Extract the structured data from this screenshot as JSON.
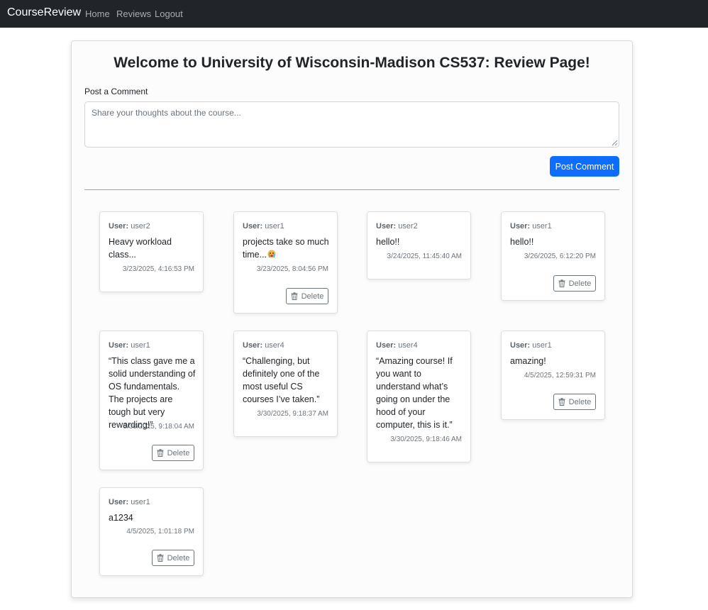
{
  "navbar": {
    "brand": "CourseReview",
    "links": [
      "Home",
      "Reviews",
      "Logout"
    ]
  },
  "page": {
    "title": "Welcome to University of Wisconsin-Madison CS537: Review Page!",
    "post_label": "Post a Comment",
    "comment_placeholder": "Share your thoughts about the course...",
    "post_button": "Post Comment"
  },
  "colors": {
    "navbar_bg": "#212529",
    "primary": "#0d6efd",
    "secondary": "#6c757d"
  },
  "user_prefix": "User:",
  "delete_label": "Delete",
  "reviews": [
    {
      "user": "user2",
      "text": "Heavy workload class...",
      "timestamp": "3/23/2025, 4:16:53 PM",
      "deletable": false
    },
    {
      "user": "user1",
      "text": "projects take so much time...",
      "emoji": "crying-face-icon",
      "timestamp": "3/23/2025, 8:04:56 PM",
      "deletable": true
    },
    {
      "user": "user2",
      "text": "hello!!",
      "timestamp": "3/24/2025, 11:45:40 AM",
      "deletable": false
    },
    {
      "user": "user1",
      "text": "hello!!",
      "timestamp": "3/26/2025, 6:12:20 PM",
      "deletable": true
    },
    {
      "user": "user1",
      "text": "“This class gave me a solid understanding of OS fundamentals. The projects are tough but very rewarding!”",
      "timestamp": "3/30/2025, 9:18:04 AM",
      "deletable": true
    },
    {
      "user": "user4",
      "text": "“Challenging, but definitely one of the most useful CS courses I’ve taken.”",
      "timestamp": "3/30/2025, 9:18:37 AM",
      "deletable": false
    },
    {
      "user": "user4",
      "text": "“Amazing course! If you want to understand what’s going on under the hood of your computer, this is it.”",
      "timestamp": "3/30/2025, 9:18:46 AM",
      "deletable": false
    },
    {
      "user": "user1",
      "text": "amazing!",
      "timestamp": "4/5/2025, 12:59:31 PM",
      "deletable": true
    },
    {
      "user": "user1",
      "text": "a1234",
      "timestamp": "4/5/2025, 1:01:18 PM",
      "deletable": true
    }
  ]
}
